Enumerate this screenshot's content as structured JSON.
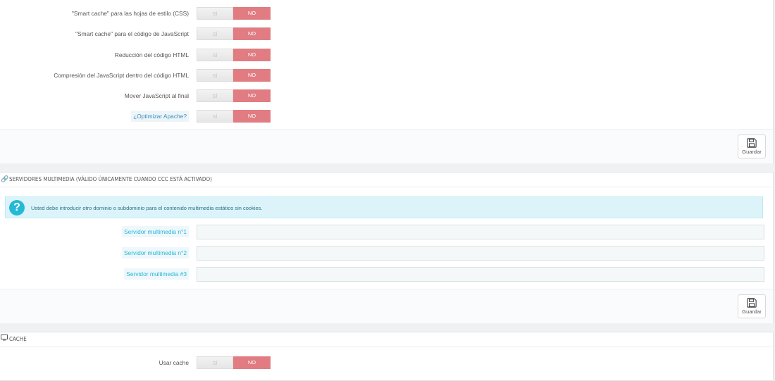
{
  "perf": {
    "rows": [
      {
        "label": "\"Smart cache\" para las hojas de estilo (CSS)",
        "yes": "SÍ",
        "no": "NO"
      },
      {
        "label": "\"Smart cache\" para el código de JavaScript",
        "yes": "SÍ",
        "no": "NO"
      },
      {
        "label": "Reducción del código HTML",
        "yes": "SÍ",
        "no": "NO"
      },
      {
        "label": "Compresión del JavaScript dentro del código HTML",
        "yes": "SÍ",
        "no": "NO"
      },
      {
        "label": "Mover JavaScript al final",
        "yes": "SÍ",
        "no": "NO"
      },
      {
        "label": "¿Optimizar Apache?",
        "yes": "SÍ",
        "no": "NO"
      }
    ],
    "save_label": "Guardar"
  },
  "media": {
    "title": "SERVIDORES MULTIMEDIA (VÁLIDO ÚNICAMENTE CUANDO CCC ESTÁ ACTIVADO)",
    "title_icon": "link-icon",
    "alert_text": "Usted debe introducir otro dominio o subdominio para el contenido multimedia estático sin cookies.",
    "fields": [
      {
        "label": "Servidor multimedia n°1",
        "value": ""
      },
      {
        "label": "Servidor multimedia n°2",
        "value": ""
      },
      {
        "label": "Servidor multimedia #3",
        "value": ""
      }
    ],
    "save_label": "Guardar"
  },
  "cache": {
    "title": "CACHE",
    "title_icon": "monitor-icon",
    "rows": [
      {
        "label": "Usar cache",
        "yes": "SÍ",
        "no": "NO"
      }
    ]
  },
  "colors": {
    "no_active": "#e07c82",
    "info_bg": "#dcf4f9",
    "accent": "#25b9d7"
  }
}
